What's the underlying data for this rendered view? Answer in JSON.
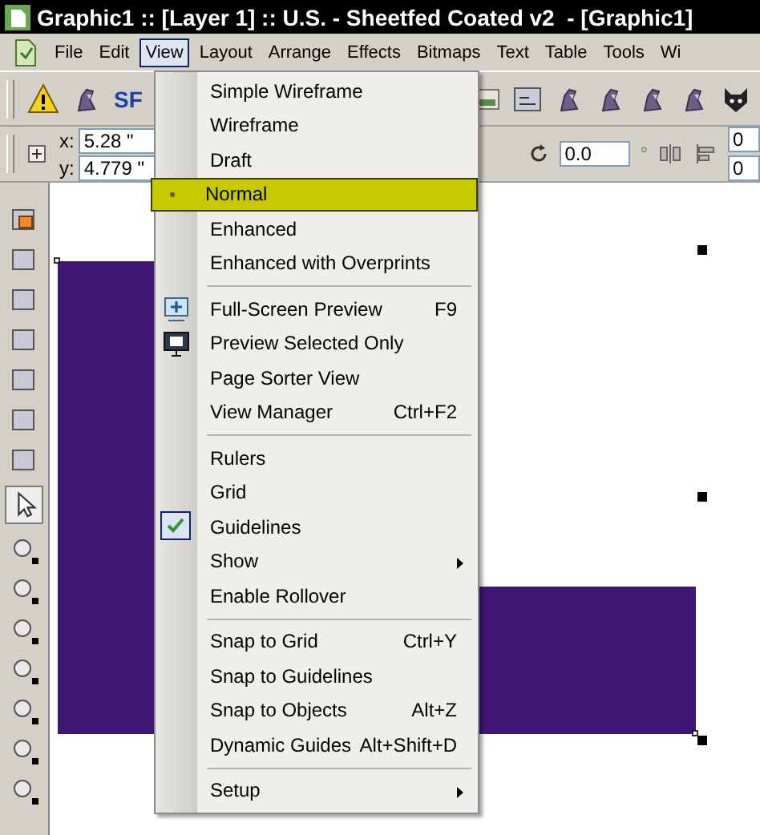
{
  "window": {
    "title": "Graphic1 :: [Layer 1] :: U.S. - Sheetfed Coated v2  - [Graphic1]"
  },
  "menu_bar": [
    {
      "label": "File",
      "selected": false
    },
    {
      "label": "Edit",
      "selected": false
    },
    {
      "label": "View",
      "selected": true
    },
    {
      "label": "Layout",
      "selected": false
    },
    {
      "label": "Arrange",
      "selected": false
    },
    {
      "label": "Effects",
      "selected": false
    },
    {
      "label": "Bitmaps",
      "selected": false
    },
    {
      "label": "Text",
      "selected": false
    },
    {
      "label": "Table",
      "selected": false
    },
    {
      "label": "Tools",
      "selected": false
    },
    {
      "label": "Wi",
      "selected": false
    }
  ],
  "toolbar": {
    "sf_label": "SF"
  },
  "property_bar": {
    "x_label": "x:",
    "x_value": "5.28 \"",
    "y_label": "y:",
    "y_value": "4.779 \"",
    "angle_value": "0.0",
    "degree_sign": "°",
    "field_1": "0",
    "field_2": "0"
  },
  "view_menu": {
    "items": [
      {
        "kind": "radio",
        "label": "Simple Wireframe",
        "checked": false,
        "highlighted": false
      },
      {
        "kind": "radio",
        "label": "Wireframe",
        "checked": false,
        "highlighted": false
      },
      {
        "kind": "radio",
        "label": "Draft",
        "checked": false,
        "highlighted": false
      },
      {
        "kind": "radio",
        "label": "Normal",
        "checked": true,
        "highlighted": true
      },
      {
        "kind": "radio",
        "label": "Enhanced",
        "checked": false,
        "highlighted": false
      },
      {
        "kind": "radio",
        "label": "Enhanced with Overprints",
        "checked": false,
        "highlighted": false
      },
      {
        "kind": "separator"
      },
      {
        "kind": "icon-item",
        "label": "Full-Screen Preview",
        "shortcut": "F9",
        "checked": false,
        "highlighted": false
      },
      {
        "kind": "icon-item",
        "label": "Preview Selected Only",
        "checked": false,
        "highlighted": false
      },
      {
        "kind": "item",
        "label": "Page Sorter View",
        "checked": false,
        "highlighted": false
      },
      {
        "kind": "item",
        "label": "View Manager",
        "shortcut": "Ctrl+F2",
        "checked": false,
        "highlighted": false
      },
      {
        "kind": "separator"
      },
      {
        "kind": "item",
        "label": "Rulers",
        "checked": false,
        "highlighted": false
      },
      {
        "kind": "item",
        "label": "Grid",
        "checked": false,
        "highlighted": false
      },
      {
        "kind": "item",
        "label": "Guidelines",
        "checked": true,
        "highlighted": false
      },
      {
        "kind": "submenu",
        "label": "Show",
        "checked": false,
        "highlighted": false
      },
      {
        "kind": "item",
        "label": "Enable Rollover",
        "checked": false,
        "highlighted": false
      },
      {
        "kind": "separator"
      },
      {
        "kind": "item",
        "label": "Snap to Grid",
        "shortcut": "Ctrl+Y",
        "checked": false,
        "highlighted": false
      },
      {
        "kind": "item",
        "label": "Snap to Guidelines",
        "checked": false,
        "highlighted": false
      },
      {
        "kind": "item",
        "label": "Snap to Objects",
        "shortcut": "Alt+Z",
        "checked": false,
        "highlighted": false
      },
      {
        "kind": "item",
        "label": "Dynamic Guides",
        "shortcut": "Alt+Shift+D",
        "checked": false,
        "highlighted": false
      },
      {
        "kind": "separator"
      },
      {
        "kind": "submenu",
        "label": "Setup",
        "checked": false,
        "highlighted": false
      }
    ]
  }
}
